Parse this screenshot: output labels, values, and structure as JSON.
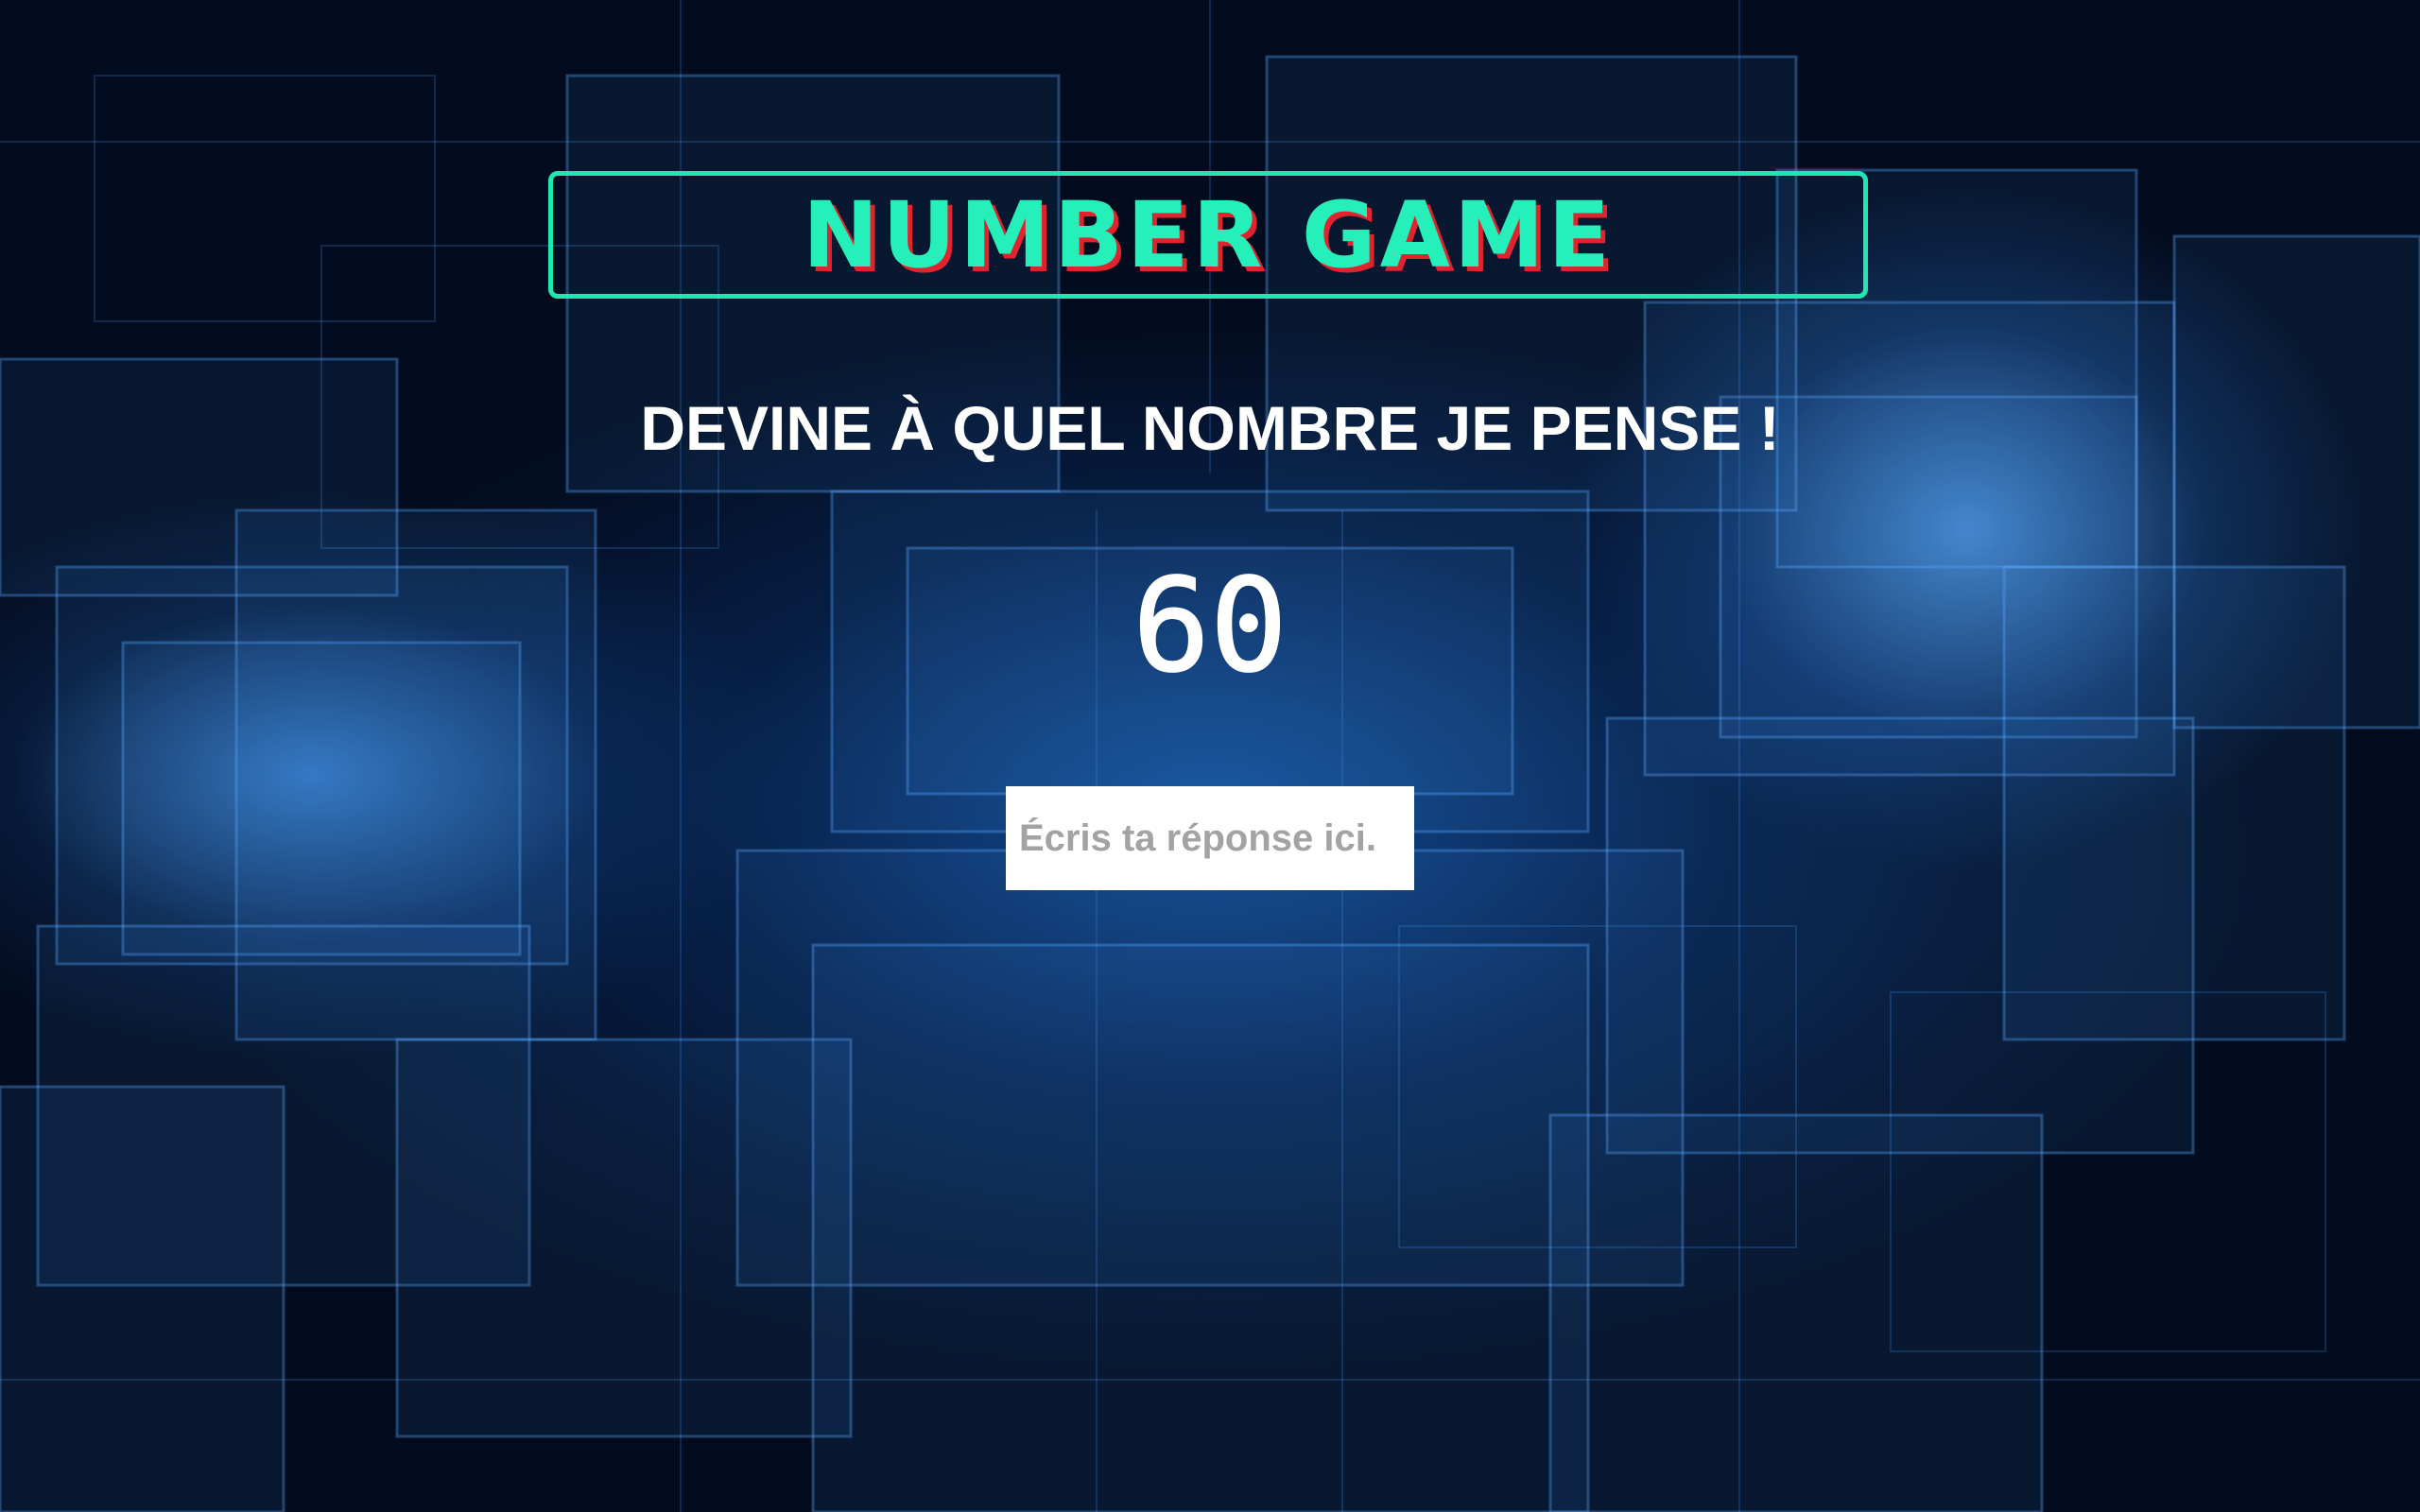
{
  "game": {
    "title": "NUMBER GAME",
    "prompt": "DEVINE À QUEL NOMBRE JE PENSE !",
    "timer": "60",
    "answer_placeholder": "Écris ta réponse ici."
  },
  "colors": {
    "title_color": "#25f0b9",
    "title_shadow": "#e0242f",
    "title_border": "#1ee8b2",
    "background": "#02060d"
  }
}
